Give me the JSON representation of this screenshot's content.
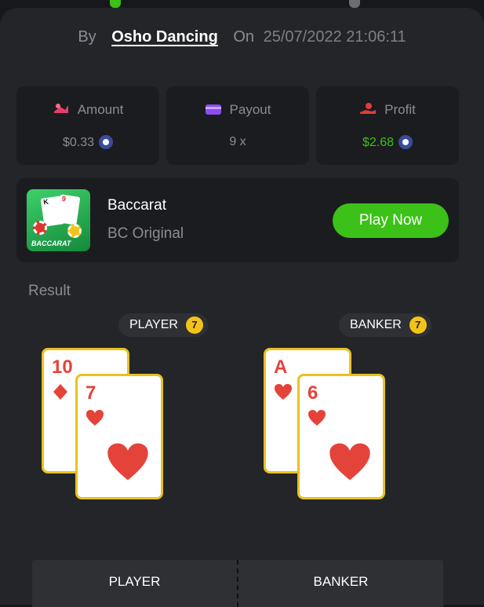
{
  "bet_info": {
    "by_label": "By",
    "author": "Osho Dancing",
    "on_label": "On",
    "datetime": "25/07/2022 21:06:11"
  },
  "stats": {
    "amount": {
      "label": "Amount",
      "value": "$0.33",
      "icon": "bet-amount-icon"
    },
    "payout": {
      "label": "Payout",
      "value": "9 x",
      "icon": "wallet-icon"
    },
    "profit": {
      "label": "Profit",
      "value": "$2.68",
      "icon": "hand-coin-icon"
    }
  },
  "game": {
    "thumb_label": "BACCARAT",
    "thumb_cards": [
      "K",
      "9"
    ],
    "title": "Baccarat",
    "subtitle": "BC Original",
    "play_label": "Play Now"
  },
  "result": {
    "label": "Result",
    "player": {
      "label": "PLAYER",
      "score": "7",
      "cards": [
        {
          "rank": "10",
          "suit": "diamond"
        },
        {
          "rank": "7",
          "suit": "heart"
        }
      ]
    },
    "banker": {
      "label": "BANKER",
      "score": "7",
      "cards": [
        {
          "rank": "A",
          "suit": "heart"
        },
        {
          "rank": "6",
          "suit": "heart"
        }
      ]
    }
  },
  "bets_bar": {
    "player_label": "PLAYER",
    "banker_label": "BANKER"
  },
  "colors": {
    "accent_green": "#3bc117",
    "card_border": "#e8c21d",
    "suit_red": "#e4433a",
    "score_badge": "#f3c21a"
  }
}
